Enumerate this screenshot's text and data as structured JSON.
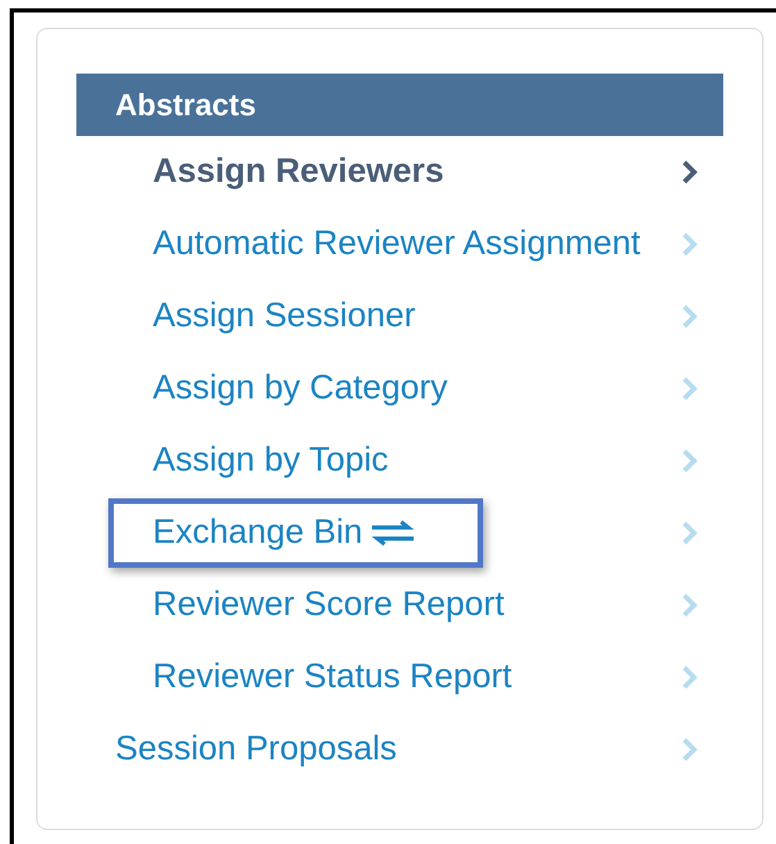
{
  "menu": {
    "header": "Abstracts",
    "items": [
      {
        "label": "Assign Reviewers",
        "kind": "sub",
        "selected": true,
        "highlighted": false,
        "exchange_icon": false
      },
      {
        "label": "Automatic Reviewer Assignment",
        "kind": "sub",
        "selected": false,
        "highlighted": false,
        "exchange_icon": false
      },
      {
        "label": "Assign Sessioner",
        "kind": "sub",
        "selected": false,
        "highlighted": false,
        "exchange_icon": false
      },
      {
        "label": "Assign by Category",
        "kind": "sub",
        "selected": false,
        "highlighted": false,
        "exchange_icon": false
      },
      {
        "label": "Assign by Topic",
        "kind": "sub",
        "selected": false,
        "highlighted": false,
        "exchange_icon": false
      },
      {
        "label": "Exchange Bin",
        "kind": "sub",
        "selected": false,
        "highlighted": true,
        "exchange_icon": true
      },
      {
        "label": "Reviewer Score Report",
        "kind": "sub",
        "selected": false,
        "highlighted": false,
        "exchange_icon": false
      },
      {
        "label": "Reviewer Status Report",
        "kind": "sub",
        "selected": false,
        "highlighted": false,
        "exchange_icon": false
      },
      {
        "label": "Session Proposals",
        "kind": "top",
        "selected": false,
        "highlighted": false,
        "exchange_icon": false
      }
    ]
  }
}
